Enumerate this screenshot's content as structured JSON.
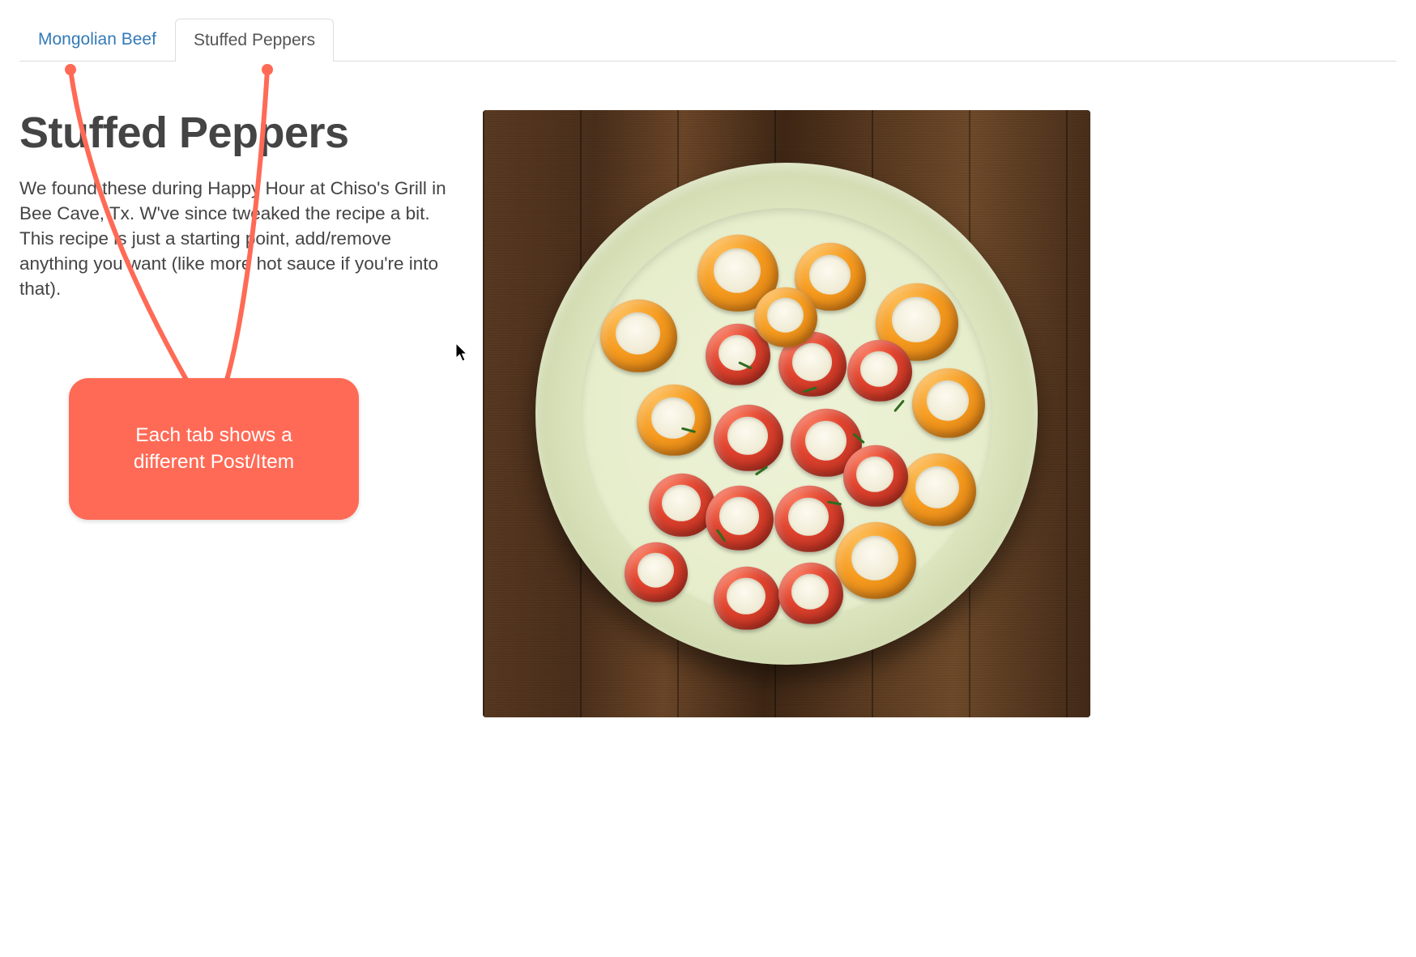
{
  "tabs": [
    {
      "label": "Mongolian Beef",
      "active": false
    },
    {
      "label": "Stuffed Peppers",
      "active": true
    }
  ],
  "post": {
    "title": "Stuffed Peppers",
    "description": "We found these during Happy Hour at Chiso's Grill in Bee Cave, Tx. W've since tweaked the recipe a bit. This recipe is just a starting point, add/remove anything you want (like more hot sauce if you're into that)."
  },
  "annotation": {
    "text": "Each tab shows a different Post/Item",
    "color": "#ff6a56"
  }
}
